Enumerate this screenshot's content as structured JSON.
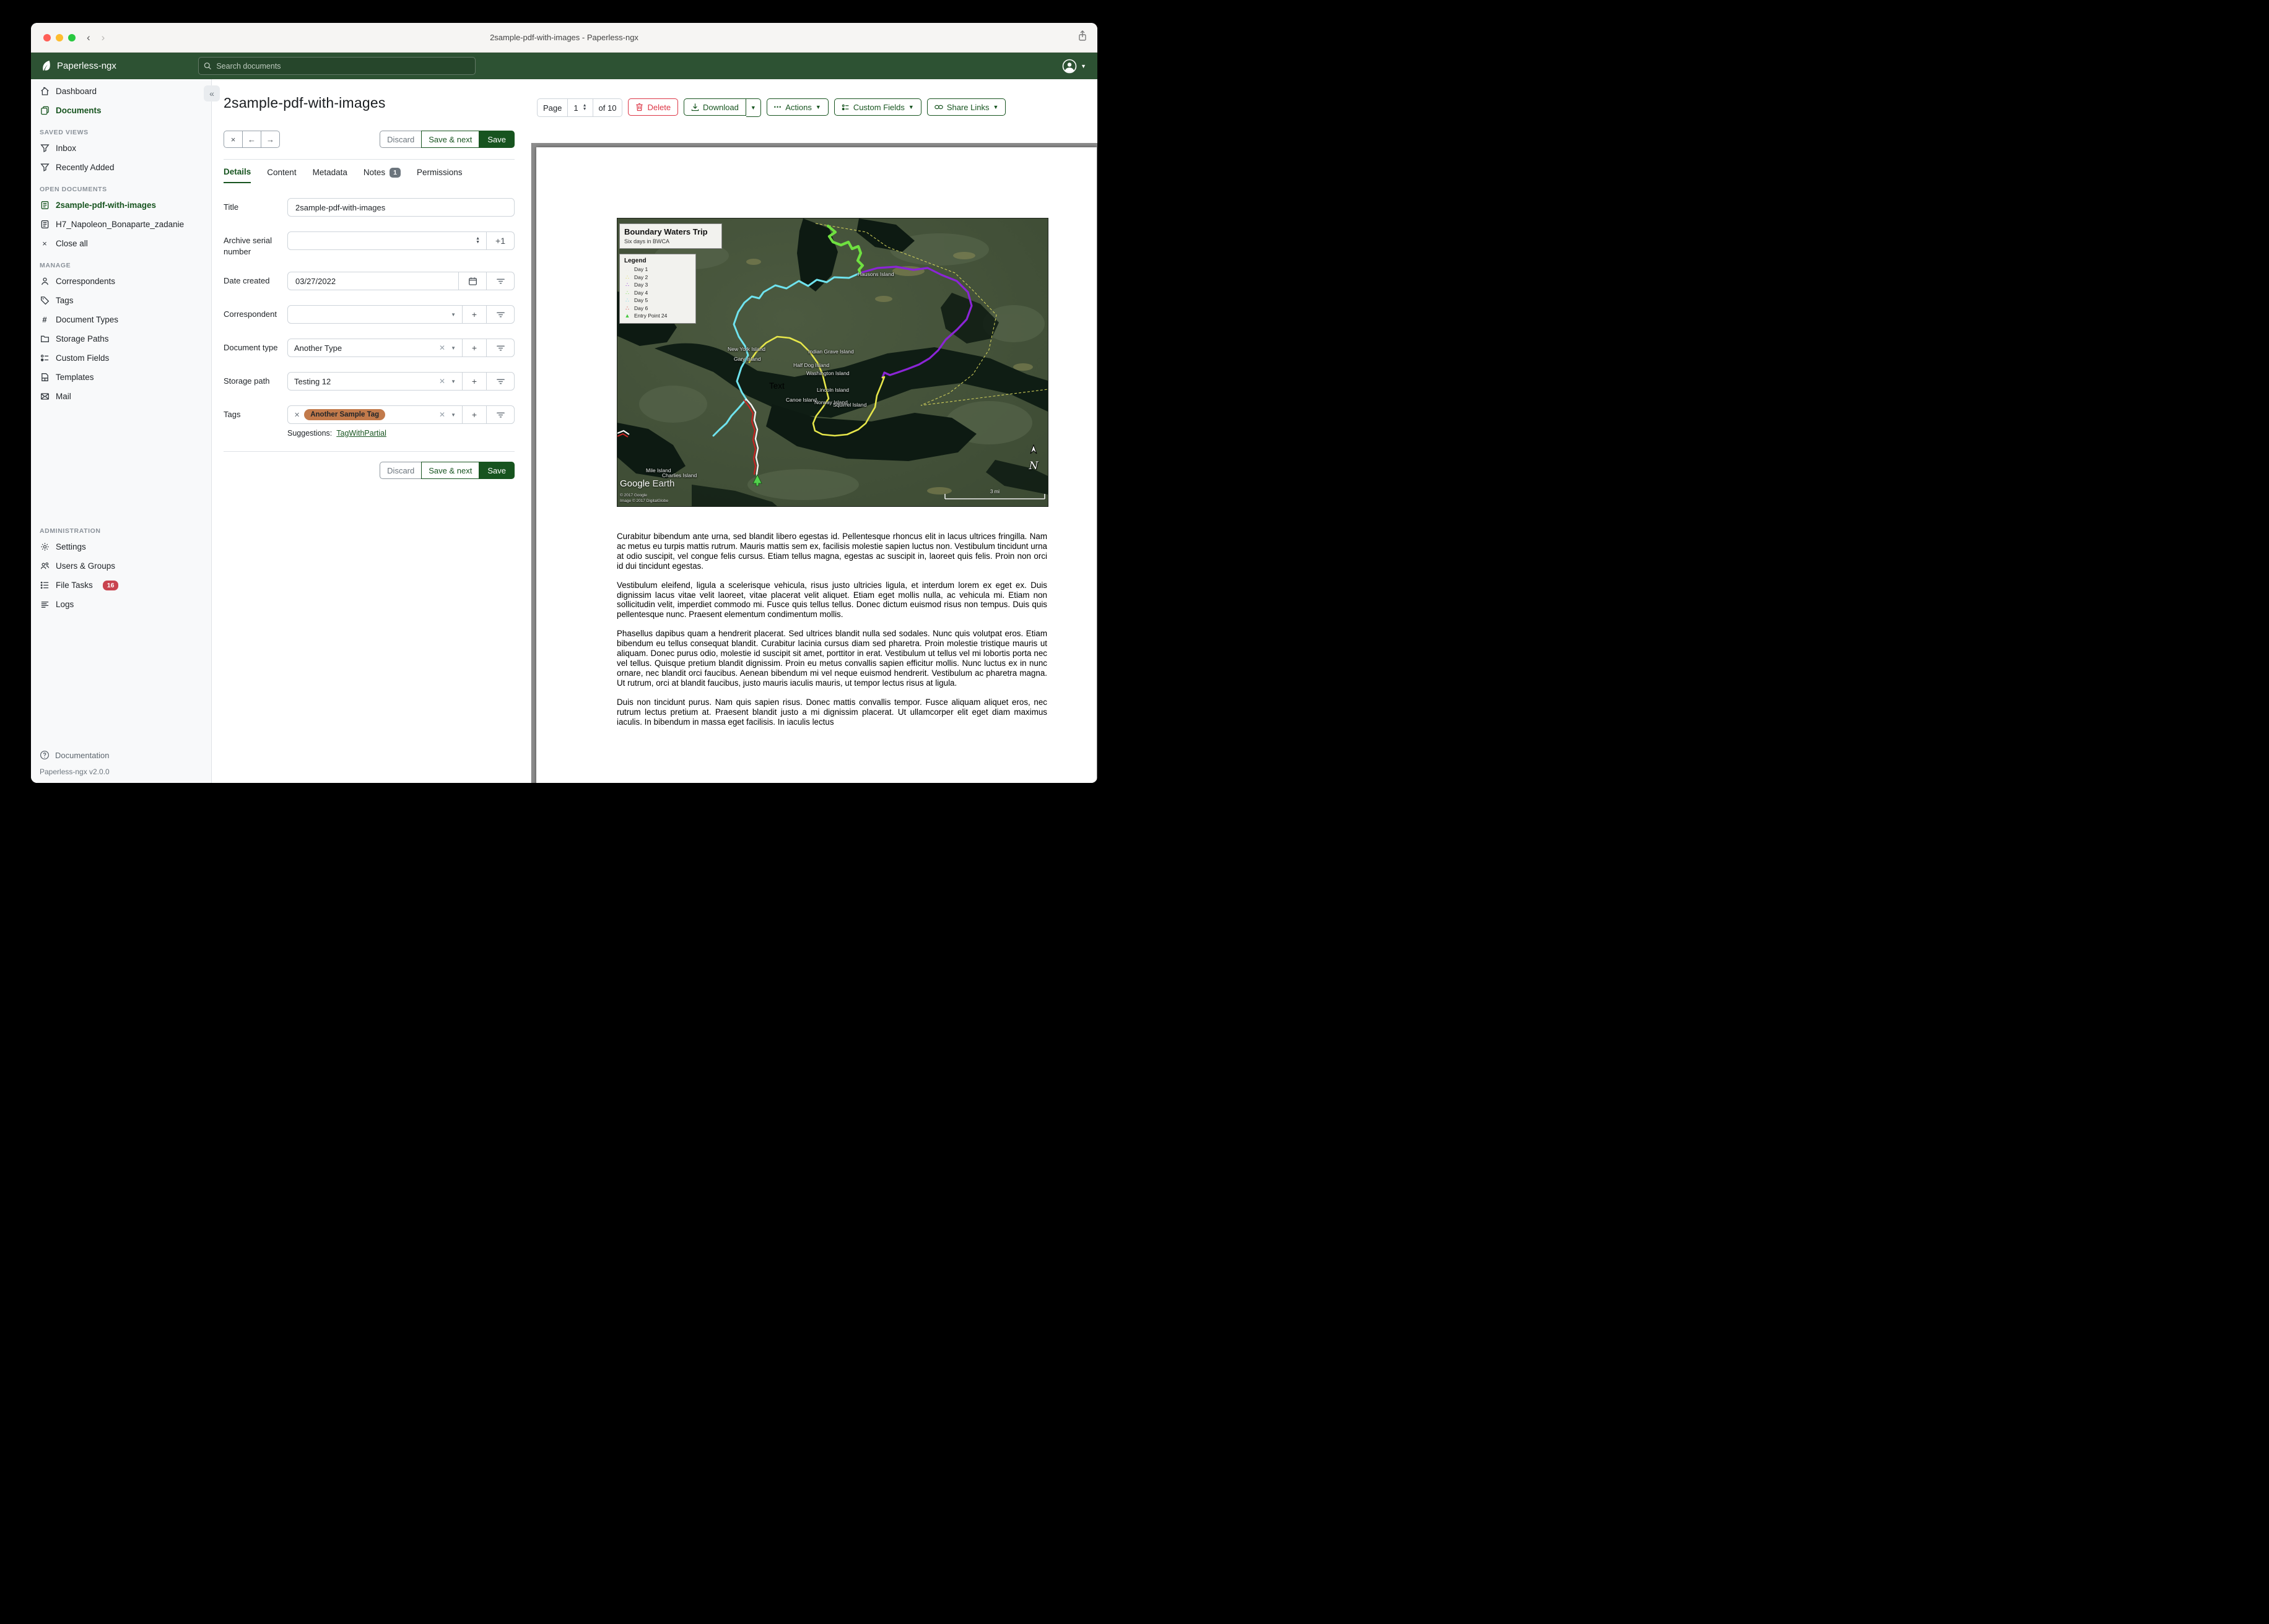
{
  "window": {
    "title": "2sample-pdf-with-images - Paperless-ngx"
  },
  "appbar": {
    "brand": "Paperless-ngx",
    "search_placeholder": "Search documents"
  },
  "sidebar": {
    "item_dashboard": "Dashboard",
    "item_documents": "Documents",
    "section_saved_views": "SAVED VIEWS",
    "item_inbox": "Inbox",
    "item_recently_added": "Recently Added",
    "section_open_documents": "OPEN DOCUMENTS",
    "item_open_doc_1": "2sample-pdf-with-images",
    "item_open_doc_2": "H7_Napoleon_Bonaparte_zadanie",
    "item_close_all": "Close all",
    "section_manage": "MANAGE",
    "item_correspondents": "Correspondents",
    "item_tags": "Tags",
    "item_document_types": "Document Types",
    "item_storage_paths": "Storage Paths",
    "item_custom_fields": "Custom Fields",
    "item_templates": "Templates",
    "item_mail": "Mail",
    "section_administration": "ADMINISTRATION",
    "item_settings": "Settings",
    "item_users_groups": "Users & Groups",
    "item_file_tasks": "File Tasks",
    "badge_file_tasks": "16",
    "item_logs": "Logs",
    "footer_documentation": "Documentation",
    "footer_version": "Paperless-ngx v2.0.0"
  },
  "toolbar": {
    "page_label": "Page",
    "page_value": "1",
    "page_of": "of 10",
    "delete_label": "Delete",
    "download_label": "Download",
    "actions_label": "Actions",
    "actions_dots": "•••",
    "custom_fields_label": "Custom Fields",
    "share_links_label": "Share Links"
  },
  "document": {
    "title": "2sample-pdf-with-images",
    "nav": {
      "close": "×",
      "prev": "←",
      "next": "→"
    },
    "actions": {
      "discard": "Discard",
      "save_next": "Save & next",
      "save": "Save"
    },
    "tabs": {
      "details": "Details",
      "content": "Content",
      "metadata": "Metadata",
      "notes": "Notes",
      "notes_badge": "1",
      "permissions": "Permissions"
    },
    "fields": {
      "title_label": "Title",
      "title_value": "2sample-pdf-with-images",
      "asn_label": "Archive serial number",
      "asn_value": "",
      "asn_plus_one": "+1",
      "date_created_label": "Date created",
      "date_created_value": "03/27/2022",
      "correspondent_label": "Correspondent",
      "correspondent_value": "",
      "document_type_label": "Document type",
      "document_type_value": "Another Type",
      "storage_path_label": "Storage path",
      "storage_path_value": "Testing 12",
      "tags_label": "Tags",
      "tag_value": "Another Sample Tag",
      "tag_color": "#c27a4b",
      "suggestions_label": "Suggestions:",
      "suggestion_link": "TagWithPartial"
    }
  },
  "preview": {
    "map": {
      "title": "Boundary Waters Trip",
      "subtitle": "Six days in BWCA",
      "legend_title": "Legend",
      "legend": {
        "0": {
          "label": "Day 1",
          "color": "#e8e8e8"
        },
        "1": {
          "label": "Day 2",
          "color": "#d9d948"
        },
        "2": {
          "label": "Day 3",
          "color": "#8b25d6"
        },
        "3": {
          "label": "Day 4",
          "color": "#6fe040"
        },
        "4": {
          "label": "Day 5",
          "color": "#62dbe8"
        },
        "5": {
          "label": "Day 6",
          "color": "#cc2727"
        },
        "6": {
          "label": "Entry Point 24",
          "color": "#45c93f"
        }
      },
      "labels": {
        "hausons": "Hausons Island",
        "new_york": "New York Island",
        "gary": "Gary Island",
        "indian_grave": "Indian Grave Island",
        "half_dog": "Half Dog Island",
        "washington": "Washington Island",
        "lincoln": "Lincoln Island",
        "canoe": "Canoe Island",
        "norway": "Norway Island",
        "squirrel": "Squirrel Island",
        "mile": "Mile Island",
        "charlies": "Charlies Island",
        "text_label": "Text"
      },
      "attribution_brand": "Google",
      "attribution_brand2": "Earth",
      "attribution_line1": "© 2017 Google",
      "attribution_line2": "Image © 2017 DigitalGlobe",
      "compass": "N",
      "scale": "3 mi"
    },
    "paragraphs": {
      "0": "Curabitur bibendum ante urna, sed blandit libero egestas id. Pellentesque rhoncus elit in lacus ultrices fringilla. Nam ac metus eu turpis mattis rutrum. Mauris mattis sem ex, facilisis molestie sapien luctus non. Vestibulum tincidunt urna at odio suscipit, vel congue felis cursus. Etiam tellus magna, egestas ac suscipit in, laoreet quis felis. Proin non orci id dui tincidunt egestas.",
      "1": "Vestibulum eleifend, ligula a scelerisque vehicula, risus justo ultricies ligula, et interdum lorem ex eget ex. Duis dignissim lacus vitae velit laoreet, vitae placerat velit aliquet. Etiam eget mollis nulla, ac vehicula mi. Etiam non sollicitudin velit, imperdiet commodo mi. Fusce quis tellus tellus. Donec dictum euismod risus non tempus. Duis quis pellentesque nunc. Praesent elementum condimentum mollis.",
      "2": "Phasellus dapibus quam a hendrerit placerat. Sed ultrices blandit nulla sed sodales. Nunc quis volutpat eros. Etiam bibendum eu tellus consequat blandit. Curabitur lacinia cursus diam sed pharetra. Proin molestie tristique mauris ut aliquam. Donec purus odio, molestie id suscipit sit amet, porttitor in erat. Vestibulum ut tellus vel mi lobortis porta nec vel tellus. Quisque pretium blandit dignissim. Proin eu metus convallis sapien efficitur mollis. Nunc luctus ex in nunc ornare, nec blandit orci faucibus. Aenean bibendum mi vel neque euismod hendrerit. Vestibulum ac pharetra magna. Ut rutrum, orci at blandit faucibus, justo mauris iaculis mauris, ut tempor lectus risus at ligula.",
      "3": "Duis non tincidunt purus. Nam quis sapien risus. Donec mattis convallis tempor. Fusce aliquam aliquet eros, nec rutrum lectus pretium at. Praesent blandit justo a mi dignissim placerat. Ut ullamcorper elit eget diam maximus iaculis. In bibendum in massa eget facilisis. In iaculis lectus"
    }
  }
}
